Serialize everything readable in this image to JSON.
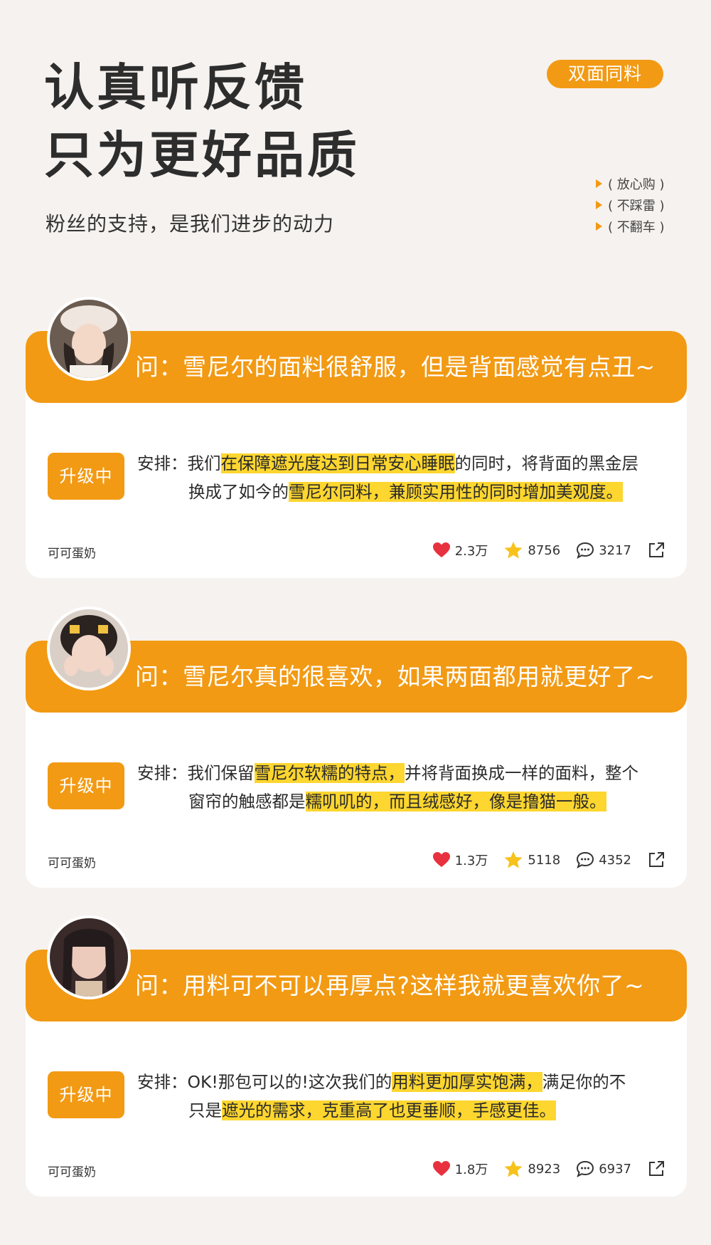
{
  "header": {
    "title_line1": "认真听反馈",
    "title_line2": "只为更好品质",
    "subtitle": "粉丝的支持，是我们进步的动力",
    "badge": "双面同料",
    "tags": [
      "( 放心购 )",
      "( 不踩雷 )",
      "( 不翻车 )"
    ]
  },
  "colors": {
    "accent": "#f29a14",
    "highlight": "#fdd62f",
    "background": "#f6f2ef",
    "heart": "#e8313f",
    "star": "#f7c21b"
  },
  "cards": [
    {
      "question": "问：雪尼尔的面料很舒服，但是背面感觉有点丑~",
      "status": "升级中",
      "answer_line1": {
        "a": "安排：我们",
        "hl": "在保障遮光度达到日常安心睡眠",
        "b": "的同时，将背面的黑金层"
      },
      "answer_line2": {
        "a": "换成了如今的",
        "hl": "雪尼尔同料，兼顾实用性的同时增加美观度。",
        "b": ""
      },
      "author": "可可蛋奶",
      "likes": "2.3万",
      "stars": "8756",
      "comments": "3217"
    },
    {
      "question": "问：雪尼尔真的很喜欢，如果两面都用就更好了~",
      "status": "升级中",
      "answer_line1": {
        "a": "安排：我们保留",
        "hl": "雪尼尔软糯的特点，",
        "b": "并将背面换成一样的面料，整个"
      },
      "answer_line2": {
        "a": "窗帘的触感都是",
        "hl": "糯叽叽的，而且绒感好，像是撸猫一般。",
        "b": ""
      },
      "author": "可可蛋奶",
      "likes": "1.3万",
      "stars": "5118",
      "comments": "4352"
    },
    {
      "question": "问：用料可不可以再厚点?这样我就更喜欢你了~",
      "status": "升级中",
      "answer_line1": {
        "a": "安排：OK!那包可以的!这次我们的",
        "hl": "用料更加厚实饱满，",
        "b": "满足你的不"
      },
      "answer_line2": {
        "a": "只是",
        "hl": "遮光的需求，克重高了也更垂顺，手感更佳。",
        "b": ""
      },
      "author": "可可蛋奶",
      "likes": "1.8万",
      "stars": "8923",
      "comments": "6937"
    }
  ]
}
